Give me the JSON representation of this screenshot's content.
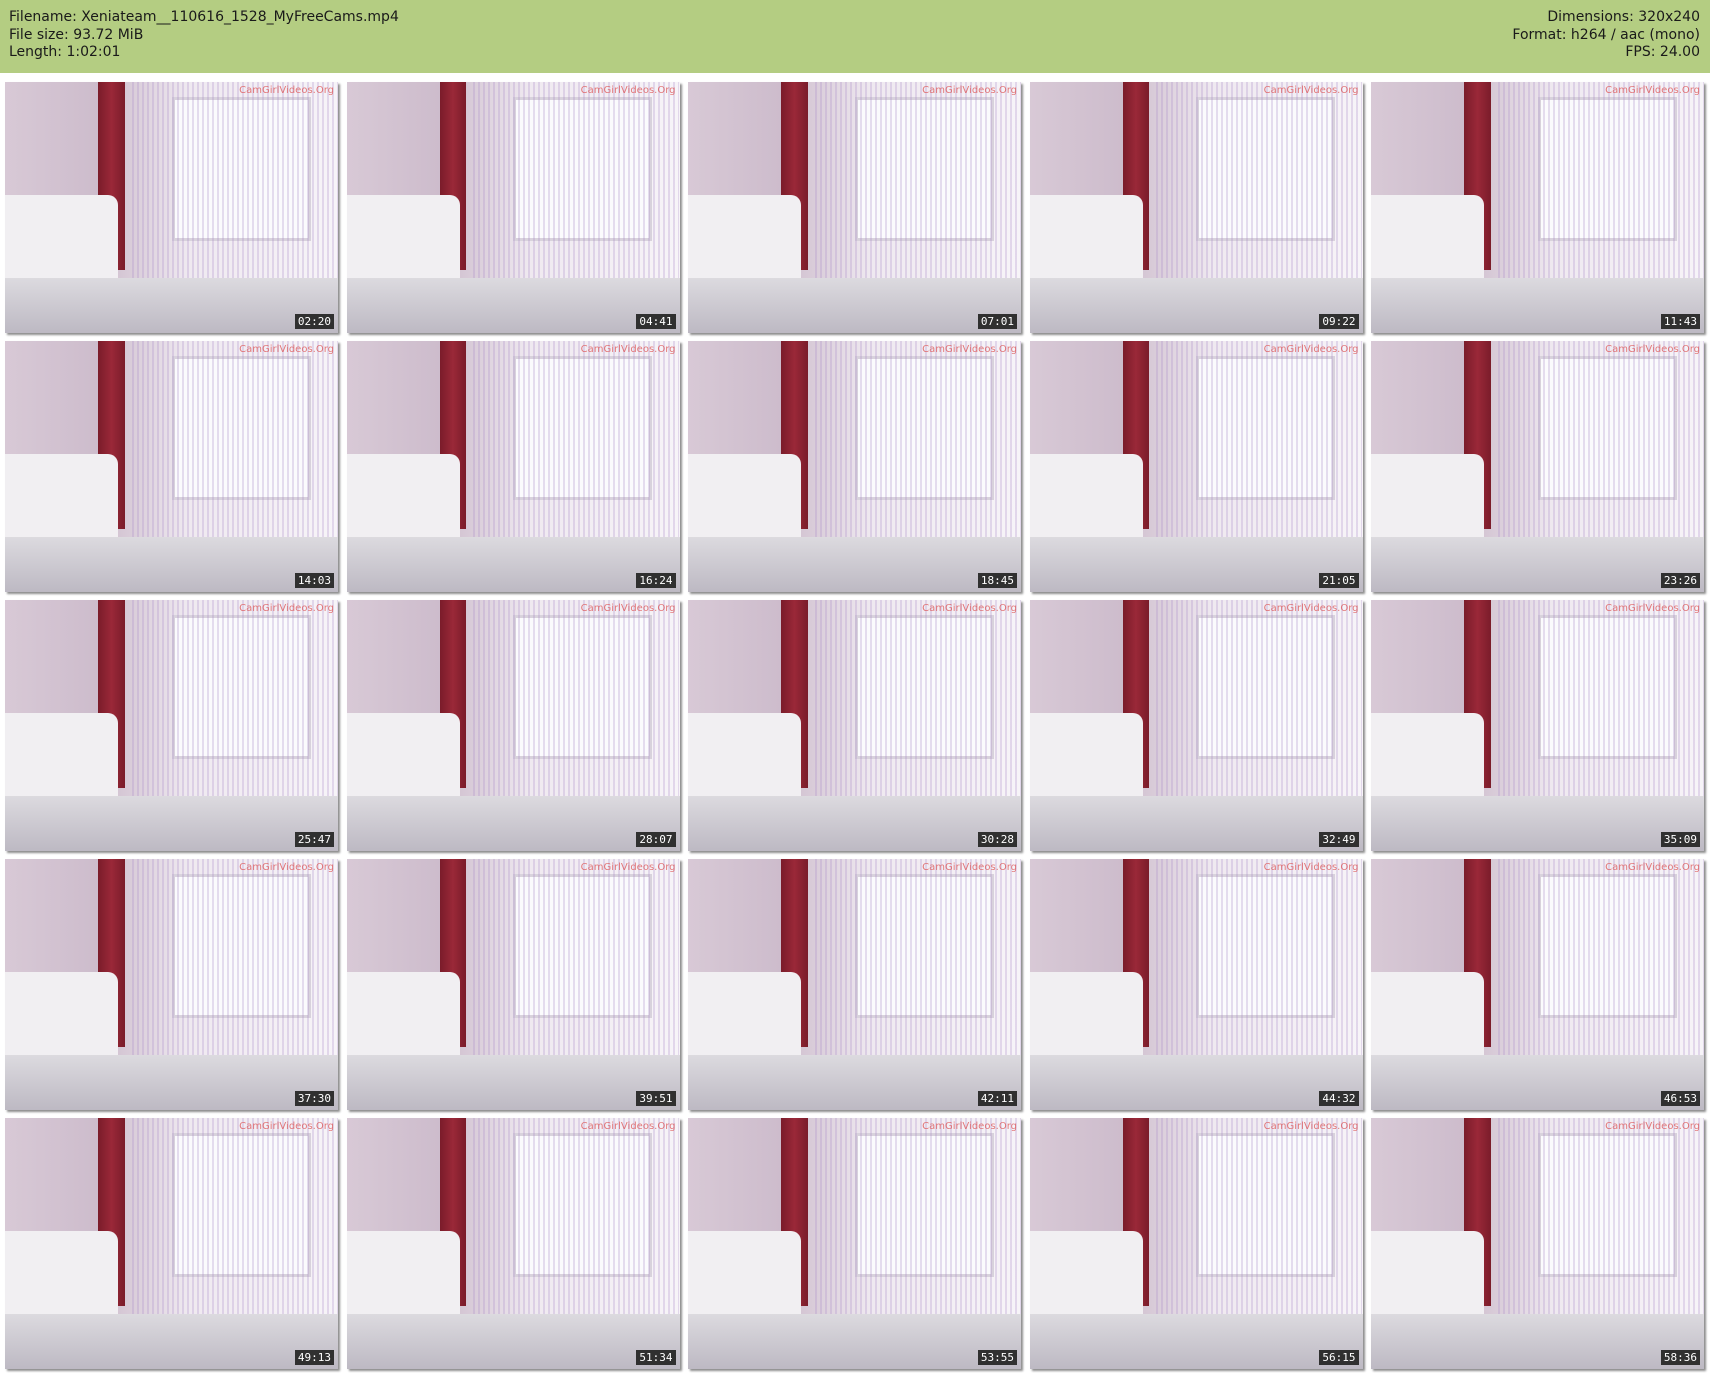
{
  "header": {
    "left": [
      "Filename: Xeniateam__110616_1528_MyFreeCams.mp4",
      "File size: 93.72 MiB",
      "Length: 1:02:01"
    ],
    "right": [
      "Dimensions: 320x240",
      "Format: h264 / aac (mono)",
      "FPS: 24.00"
    ],
    "background": "#b4cd82"
  },
  "watermark": "CamGirlVideos.Org",
  "thumbnails": [
    {
      "time": "02:20"
    },
    {
      "time": "04:41"
    },
    {
      "time": "07:01"
    },
    {
      "time": "09:22"
    },
    {
      "time": "11:43"
    },
    {
      "time": "14:03"
    },
    {
      "time": "16:24"
    },
    {
      "time": "18:45"
    },
    {
      "time": "21:05"
    },
    {
      "time": "23:26"
    },
    {
      "time": "25:47"
    },
    {
      "time": "28:07"
    },
    {
      "time": "30:28"
    },
    {
      "time": "32:49"
    },
    {
      "time": "35:09"
    },
    {
      "time": "37:30"
    },
    {
      "time": "39:51"
    },
    {
      "time": "42:11"
    },
    {
      "time": "44:32"
    },
    {
      "time": "46:53"
    },
    {
      "time": "49:13"
    },
    {
      "time": "51:34"
    },
    {
      "time": "53:55"
    },
    {
      "time": "56:15"
    },
    {
      "time": "58:36"
    }
  ]
}
